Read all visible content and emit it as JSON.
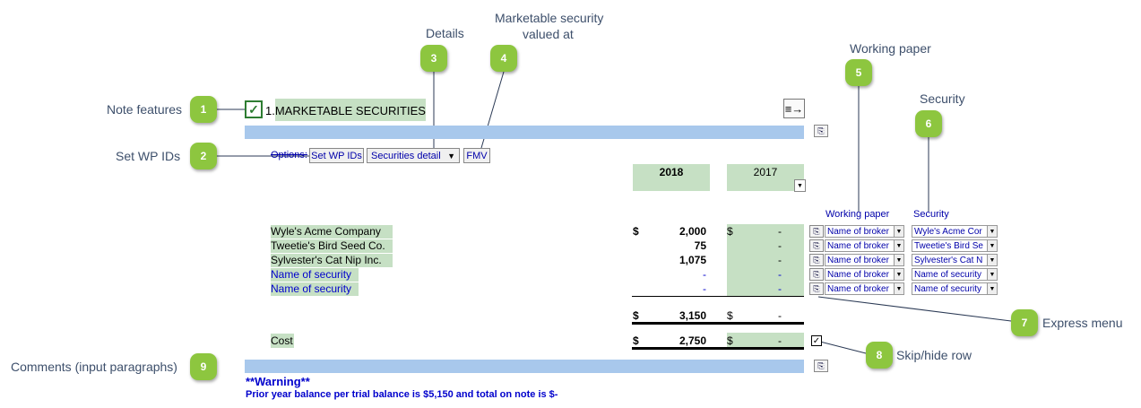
{
  "callouts": {
    "note_features": "Note features",
    "set_wp_ids": "Set WP IDs",
    "details": "Details",
    "marketable_security_line1": "Marketable security",
    "marketable_security_line2": "valued at",
    "working_paper": "Working paper",
    "security": "Security",
    "express_menu": "Express menu",
    "skip_hide_row": "Skip/hide row",
    "comments": "Comments (input paragraphs)",
    "numbers": [
      "1",
      "2",
      "3",
      "4",
      "5",
      "6",
      "7",
      "8",
      "9"
    ]
  },
  "note": {
    "title": "1.MARKETABLE SECURITIES",
    "options_label": "Options:",
    "set_wp_ids_btn": "Set WP IDs",
    "securities_detail_dd": "Securities detail",
    "fmv_btn": "FMV",
    "year_current": "2018",
    "year_prior": "2017",
    "col_working_paper": "Working paper",
    "col_security": "Security"
  },
  "rows": [
    {
      "label": "Wyle's Acme Company",
      "dollar": "$",
      "current": "2,000",
      "prior_dollar": "$",
      "prior": "-",
      "wp": "Name of broker",
      "sec": "Wyle's Acme Cor"
    },
    {
      "label": "Tweetie's Bird Seed Co.",
      "dollar": "",
      "current": "75",
      "prior_dollar": "",
      "prior": "-",
      "wp": "Name of broker",
      "sec": "Tweetie's Bird Se"
    },
    {
      "label": "Sylvester's Cat Nip Inc.",
      "dollar": "",
      "current": "1,075",
      "prior_dollar": "",
      "prior": "-",
      "wp": "Name of broker",
      "sec": "Sylvester's Cat N"
    },
    {
      "label": "Name of security",
      "dollar": "",
      "current": "-",
      "prior_dollar": "",
      "prior": "-",
      "wp": "Name of broker",
      "sec": "Name of security"
    },
    {
      "label": "Name of security",
      "dollar": "",
      "current": "-",
      "prior_dollar": "",
      "prior": "-",
      "wp": "Name of broker",
      "sec": "Name of security"
    }
  ],
  "totals": {
    "dollar": "$",
    "current": "3,150",
    "prior_dollar": "$",
    "prior": "-"
  },
  "cost": {
    "label": "Cost",
    "dollar": "$",
    "current": "2,750",
    "prior_dollar": "$",
    "prior": "-"
  },
  "warning": {
    "title": "**Warning**",
    "message": "Prior year balance per trial balance is $5,150 and total on note is $-"
  }
}
